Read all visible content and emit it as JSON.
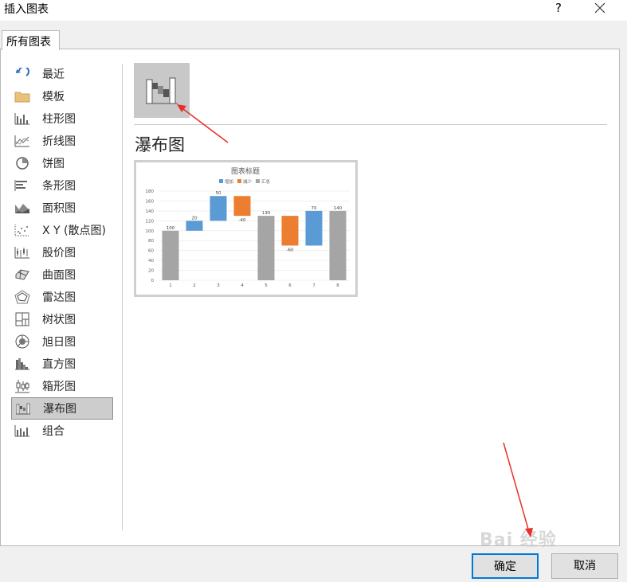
{
  "window": {
    "title": "插入图表",
    "help_label": "?"
  },
  "tab": {
    "label": "所有图表"
  },
  "chart_types": [
    {
      "label": "最近",
      "icon": "recent-icon"
    },
    {
      "label": "模板",
      "icon": "folder-icon"
    },
    {
      "label": "柱形图",
      "icon": "column-chart-icon"
    },
    {
      "label": "折线图",
      "icon": "line-chart-icon"
    },
    {
      "label": "饼图",
      "icon": "pie-chart-icon"
    },
    {
      "label": "条形图",
      "icon": "bar-chart-icon"
    },
    {
      "label": "面积图",
      "icon": "area-chart-icon"
    },
    {
      "label": "X Y (散点图)",
      "icon": "scatter-chart-icon"
    },
    {
      "label": "股价图",
      "icon": "stock-chart-icon"
    },
    {
      "label": "曲面图",
      "icon": "surface-chart-icon"
    },
    {
      "label": "雷达图",
      "icon": "radar-chart-icon"
    },
    {
      "label": "树状图",
      "icon": "treemap-chart-icon"
    },
    {
      "label": "旭日图",
      "icon": "sunburst-chart-icon"
    },
    {
      "label": "直方图",
      "icon": "histogram-chart-icon"
    },
    {
      "label": "箱形图",
      "icon": "box-whisker-chart-icon"
    },
    {
      "label": "瀑布图",
      "icon": "waterfall-chart-icon",
      "selected": true
    },
    {
      "label": "组合",
      "icon": "combo-chart-icon"
    }
  ],
  "main": {
    "heading": "瀑布图",
    "subtype_icon": "waterfall-subtype-icon"
  },
  "preview": {
    "title": "图表标题",
    "legend": [
      {
        "label": "增加",
        "color": "#5b9bd5"
      },
      {
        "label": "减少",
        "color": "#ed7d31"
      },
      {
        "label": "汇总",
        "color": "#a5a5a5"
      }
    ]
  },
  "chart_data": {
    "type": "bar",
    "subtype": "waterfall",
    "title": "图表标题",
    "categories": [
      "1",
      "2",
      "3",
      "4",
      "5",
      "6",
      "7",
      "8"
    ],
    "values": [
      100,
      20,
      50,
      -40,
      130,
      -60,
      70,
      140
    ],
    "kinds": [
      "total",
      "increase",
      "increase",
      "decrease",
      "total",
      "decrease",
      "increase",
      "total"
    ],
    "data_labels": [
      "100",
      "20",
      "50",
      "-40",
      "130",
      "-60",
      "70",
      "140"
    ],
    "y_ticks": [
      "0",
      "20",
      "40",
      "60",
      "80",
      "100",
      "120",
      "140",
      "160",
      "180"
    ],
    "ylim": [
      0,
      180
    ],
    "legend": [
      "增加",
      "减少",
      "汇总"
    ],
    "colors": {
      "increase": "#5b9bd5",
      "decrease": "#ed7d31",
      "total": "#a5a5a5"
    },
    "grid": true,
    "legend_position": "top"
  },
  "buttons": {
    "ok": "确定",
    "cancel": "取消"
  },
  "watermark": "Bai 经验"
}
